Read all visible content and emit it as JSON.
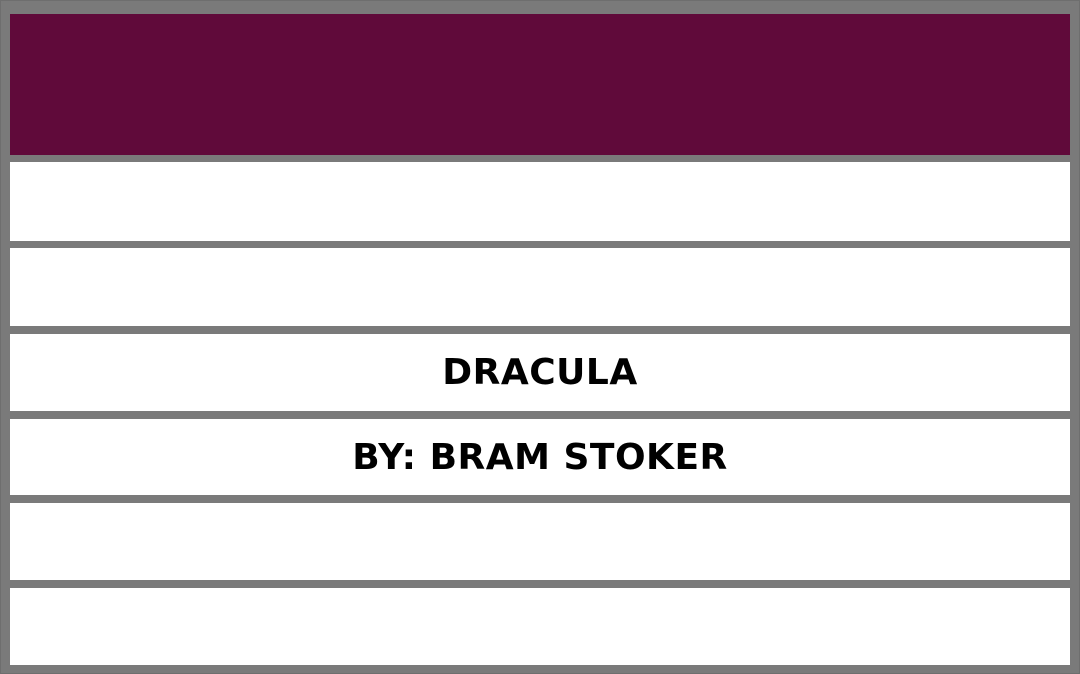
{
  "colors": {
    "header_band": "#600a3a",
    "frame": "#7a7a7a",
    "row_background": "#ffffff",
    "text": "#000000"
  },
  "card": {
    "title": "DRACULA",
    "byline": "BY: BRAM STOKER"
  }
}
